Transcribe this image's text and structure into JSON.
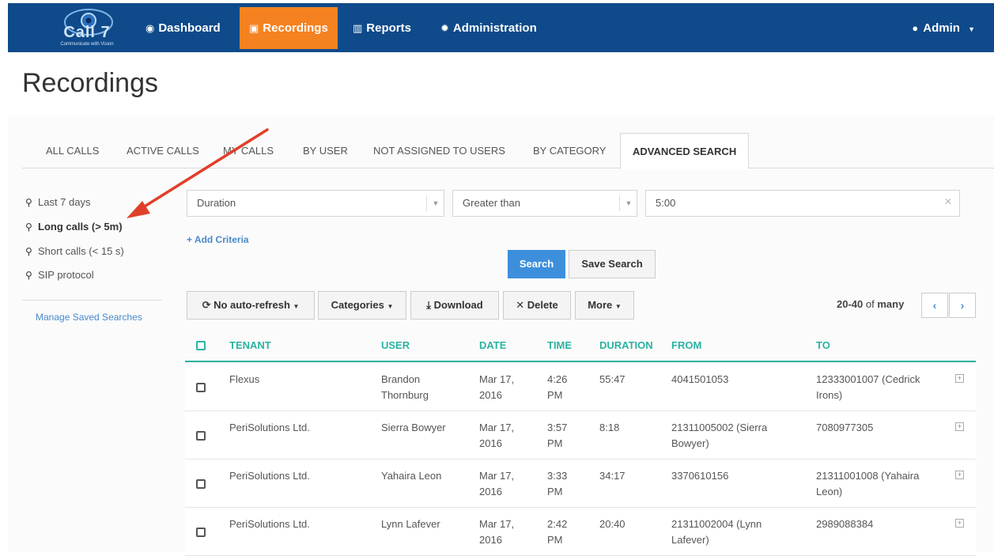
{
  "nav": {
    "brand": "Call 7",
    "brand_tagline": "Communicate with Vision",
    "items": [
      {
        "label": "Dashboard",
        "icon": "dashboard-icon"
      },
      {
        "label": "Recordings",
        "icon": "recordings-icon"
      },
      {
        "label": "Reports",
        "icon": "bar-chart-icon"
      },
      {
        "label": "Administration",
        "icon": "gear-icon"
      }
    ],
    "user": "Admin"
  },
  "page": {
    "title": "Recordings"
  },
  "tabs": [
    "ALL CALLS",
    "ACTIVE CALLS",
    "MY CALLS",
    "BY USER",
    "NOT ASSIGNED TO USERS",
    "BY CATEGORY",
    "ADVANCED SEARCH"
  ],
  "sidebar": {
    "saved_searches": [
      "Last 7 days",
      "Long calls (> 5m)",
      "Short calls (< 15 s)",
      "SIP protocol"
    ],
    "manage": "Manage Saved Searches"
  },
  "criteria": {
    "field": "Duration",
    "operator": "Greater than",
    "value": "5:00",
    "add": "+ Add Criteria"
  },
  "actions": {
    "search": "Search",
    "save_search": "Save Search",
    "auto_refresh": "No auto-refresh",
    "categories": "Categories",
    "download": "Download",
    "delete": "Delete",
    "more": "More"
  },
  "pager": {
    "range": "20-40",
    "of": "of",
    "total": "many"
  },
  "table": {
    "headers": [
      "TENANT",
      "USER",
      "DATE",
      "TIME",
      "DURATION",
      "FROM",
      "TO"
    ],
    "rows": [
      {
        "tenant": "Flexus",
        "user": [
          "Brandon",
          "Thornburg"
        ],
        "date": [
          "Mar 17,",
          "2016"
        ],
        "time": [
          "4:26",
          "PM"
        ],
        "duration": "55:47",
        "from": [
          "4041501053"
        ],
        "to": [
          "12333001007 (Cedrick",
          "Irons)"
        ]
      },
      {
        "tenant": "PeriSolutions Ltd.",
        "user": [
          "Sierra Bowyer"
        ],
        "date": [
          "Mar 17,",
          "2016"
        ],
        "time": [
          "3:57",
          "PM"
        ],
        "duration": "8:18",
        "from": [
          "21311005002 (Sierra",
          "Bowyer)"
        ],
        "to": [
          "7080977305"
        ]
      },
      {
        "tenant": "PeriSolutions Ltd.",
        "user": [
          "Yahaira Leon"
        ],
        "date": [
          "Mar 17,",
          "2016"
        ],
        "time": [
          "3:33",
          "PM"
        ],
        "duration": "34:17",
        "from": [
          "3370610156"
        ],
        "to": [
          "21311001008 (Yahaira",
          "Leon)"
        ]
      },
      {
        "tenant": "PeriSolutions Ltd.",
        "user": [
          "Lynn Lafever"
        ],
        "date": [
          "Mar 17,",
          "2016"
        ],
        "time": [
          "2:42",
          "PM"
        ],
        "duration": "20:40",
        "from": [
          "21311002004 (Lynn",
          "Lafever)"
        ],
        "to": [
          "2989088384"
        ]
      }
    ]
  },
  "colors": {
    "nav": "#0f4a8a",
    "active_nav": "#f58220",
    "accent": "#2bb3a0",
    "primary": "#3d8fdc",
    "annotation_arrow": "#e0402a"
  }
}
